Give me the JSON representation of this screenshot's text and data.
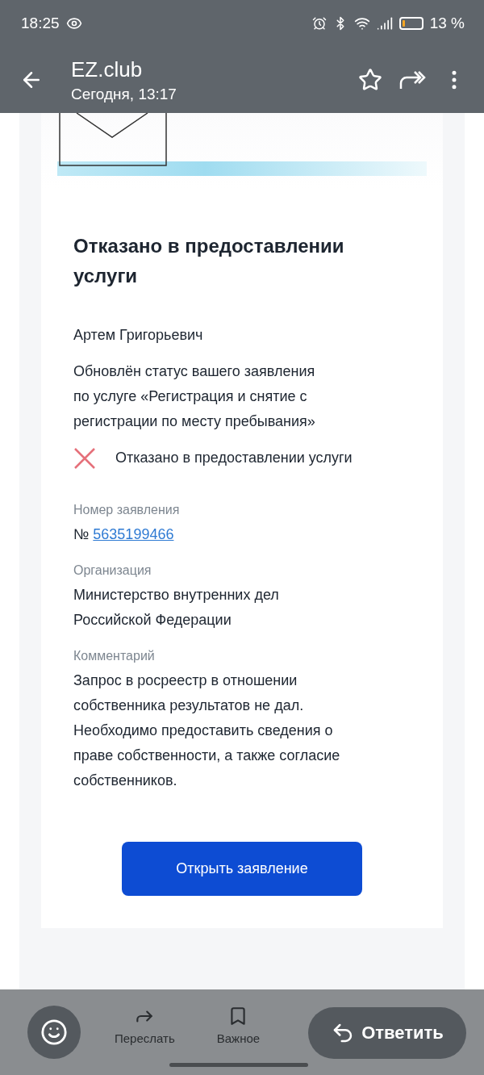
{
  "status_bar": {
    "time": "18:25",
    "battery": "13 %"
  },
  "app_bar": {
    "title": "EZ.club",
    "subtitle": "Сегодня, 13:17"
  },
  "message": {
    "heading": "Отказано в предоставлении услуги",
    "greeting": "Артем Григорьевич",
    "body": "Обновлён статус вашего заявления\nпо услуге «Регистрация и снятие с\nрегистрации по месту пребывания»",
    "status": {
      "kind": "rejected",
      "text": "Отказано в предоставлении услуги"
    },
    "fields": [
      {
        "kind": "link",
        "label": "Номер заявления",
        "prefix": "№",
        "value": "5635199466"
      },
      {
        "kind": "text",
        "label": "Организация",
        "value": "Министерство внутренних дел\nРоссийской Федерации"
      },
      {
        "kind": "text",
        "label": "Комментарий",
        "value": "Запрос в росреестр в отношении\nсобственника результатов не дал.\nНеобходимо предоставить сведения о\nправе собственности, а также согласие\nсобственников."
      }
    ],
    "button": "Открыть заявление"
  },
  "toolbar": {
    "items": [
      {
        "kind": "forward",
        "label": "Переслать"
      },
      {
        "kind": "bookmark",
        "label": "Важное"
      }
    ],
    "reply_button": "Ответить"
  }
}
